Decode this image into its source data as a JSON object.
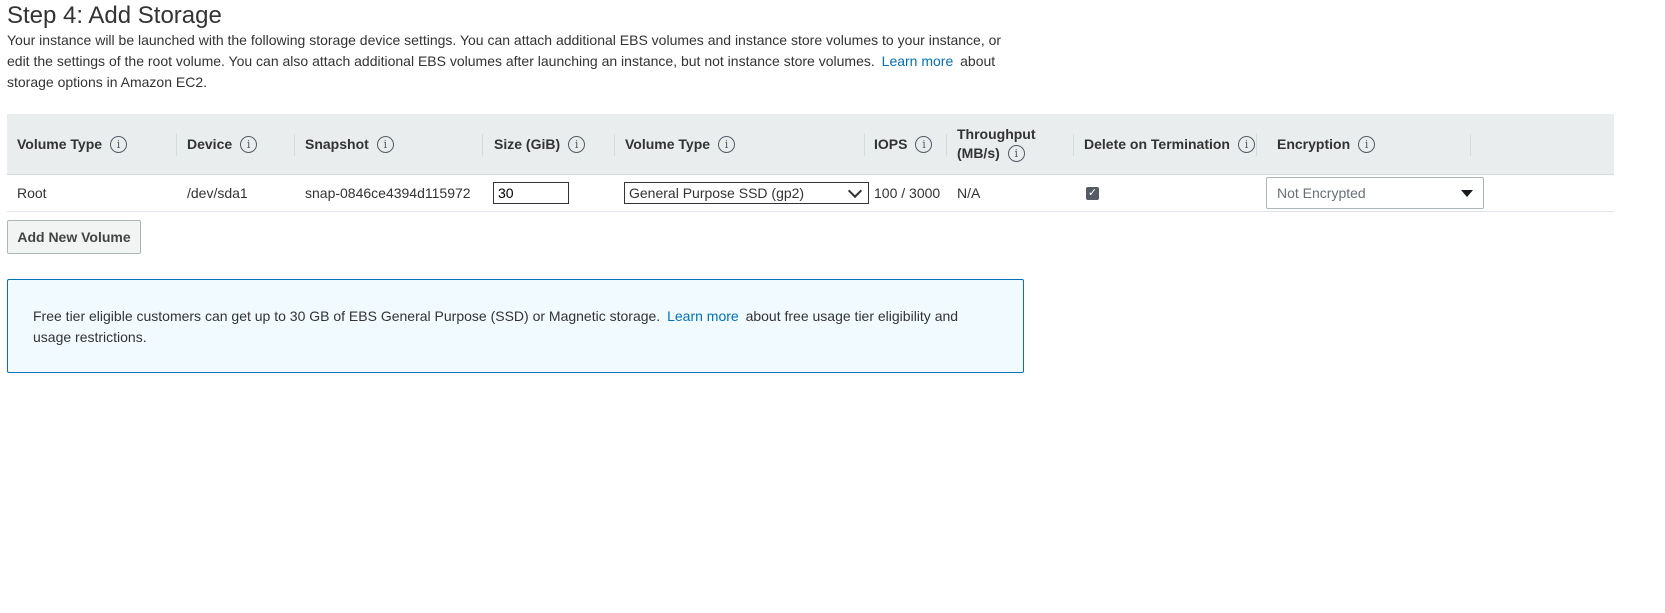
{
  "page": {
    "title": "Step 4: Add Storage",
    "description_part1": "Your instance will be launched with the following storage device settings. You can attach additional EBS volumes and instance store volumes to your instance, or edit the settings of the root volume. You can also attach additional EBS volumes after launching an instance, but not instance store volumes.",
    "learn_more": "Learn more",
    "description_part2": "about storage options in Amazon EC2."
  },
  "table": {
    "headers": {
      "volume_type": "Volume Type",
      "device": "Device",
      "snapshot": "Snapshot",
      "size": "Size (GiB)",
      "volume_type2": "Volume Type",
      "iops": "IOPS",
      "throughput_line1": "Throughput",
      "throughput_line2": "(MB/s)",
      "delete_on_termination": "Delete on Termination",
      "encryption": "Encryption"
    },
    "info_glyph": "i",
    "rows": [
      {
        "volume_type": "Root",
        "device": "/dev/sda1",
        "snapshot": "snap-0846ce4394d115972",
        "size": "30",
        "ebs_volume_type": "General Purpose SSD (gp2)",
        "iops": "100 / 3000",
        "throughput": "N/A",
        "delete_on_termination": true,
        "encryption": "Not Encrypted"
      }
    ]
  },
  "actions": {
    "add_new_volume": "Add New Volume"
  },
  "free_tier": {
    "text_part1": "Free tier eligible customers can get up to 30 GB of EBS General Purpose (SSD) or Magnetic storage.",
    "learn_more": "Learn more",
    "text_part2": "about free usage tier eligibility and usage restrictions."
  },
  "colors": {
    "link": "#0073bb",
    "header_bg": "#eaeded",
    "info_box_bg": "#f1faff",
    "info_box_border": "#0073bb"
  },
  "icons": {
    "info": "info-icon",
    "checkbox": "checkbox-checked-icon",
    "select": "chevron-down-icon",
    "dropdown": "caret-down-icon"
  }
}
